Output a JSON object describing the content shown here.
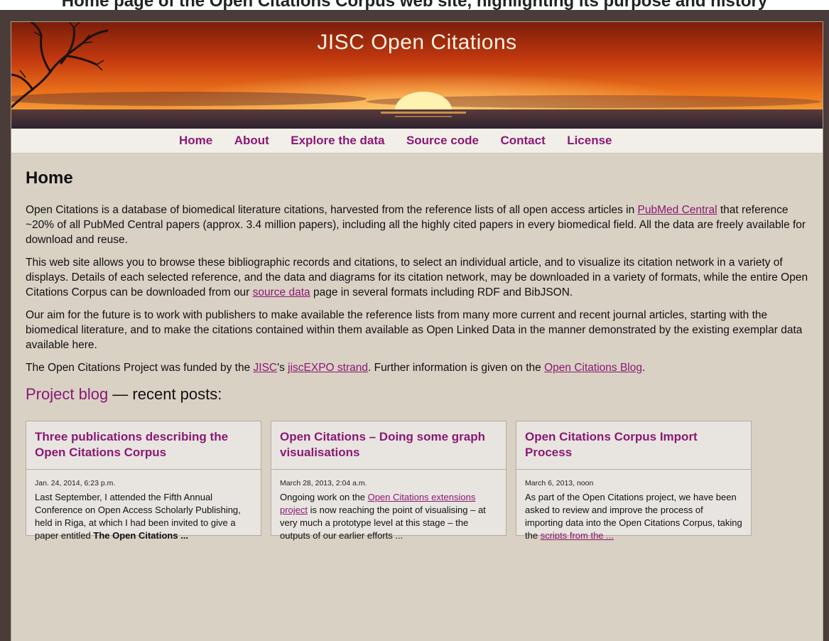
{
  "top_strip_text": "Home page of the Open Citations Corpus web site, highlighting its purpose and history",
  "site": {
    "title": "JISC Open Citations"
  },
  "nav": [
    {
      "label": "Home"
    },
    {
      "label": "About"
    },
    {
      "label": "Explore the data"
    },
    {
      "label": "Source code"
    },
    {
      "label": "Contact"
    },
    {
      "label": "License"
    }
  ],
  "main": {
    "title": "Home",
    "p1": {
      "a": "Open Citations is a database of biomedical literature citations, harvested from the reference lists of all open access articles in ",
      "link": "PubMed Central",
      "b": " that reference ~20% of all PubMed Central papers (approx. 3.4 million papers), including all the highly cited papers in every biomedical field. All the data are freely available for download and reuse."
    },
    "p2": {
      "a": "This web site allows you to browse these bibliographic records and citations, to select an individual article, and to visualize its citation network in a variety of displays. Details of each selected reference, and the data and diagrams for its citation network, may be downloaded in a variety of formats, while the entire Open Citations Corpus can be downloaded from our ",
      "link": "source data",
      "b": " page in several formats including RDF and BibJSON."
    },
    "p3": "Our aim for the future is to work with publishers to make available the reference lists from many more current and recent journal articles, starting with the biomedical literature, and to make the citations contained within them available as Open Linked Data in the manner demonstrated by the existing exemplar data available here.",
    "p4": {
      "a": "The Open Citations Project was funded by the ",
      "link1": "JISC",
      "b": "'s ",
      "link2": "jiscEXPO strand",
      "c": ". Further information is given on the ",
      "link3": "Open Citations Blog",
      "d": "."
    }
  },
  "blog": {
    "link": "Project blog",
    "suffix": " — recent posts:",
    "posts": [
      {
        "title": "Three publications describing the Open Citations Corpus",
        "date": "Jan. 24, 2014, 6:23 p.m.",
        "text_a": "Last September, I attended the Fifth Annual Conference on Open Access Scholarly Publishing, held in Riga, at which I had been invited to give a paper entitled ",
        "bold": "The Open Citations ...",
        "link": "",
        "text_b": ""
      },
      {
        "title": "Open Citations – Doing some graph visualisations",
        "date": "March 28, 2013, 2:04 a.m.",
        "text_a": "Ongoing work on the ",
        "bold": "",
        "link": "Open Citations extensions project",
        "text_b": " is now reaching the point of visualising – at very much a prototype level at this stage – the outputs of our earlier efforts ..."
      },
      {
        "title": "Open Citations Corpus Import Process",
        "date": "March 6, 2013, noon",
        "text_a": "As part of the Open Citations project, we have been asked to review and improve the process of importing data into the Open Citations Corpus, taking the ",
        "bold": "",
        "link": "scripts from the ...",
        "text_b": ""
      }
    ]
  },
  "colors": {
    "accent": "#8b1874",
    "page_bg": "#d9d1c4",
    "frame_bg": "#4a3c38"
  }
}
